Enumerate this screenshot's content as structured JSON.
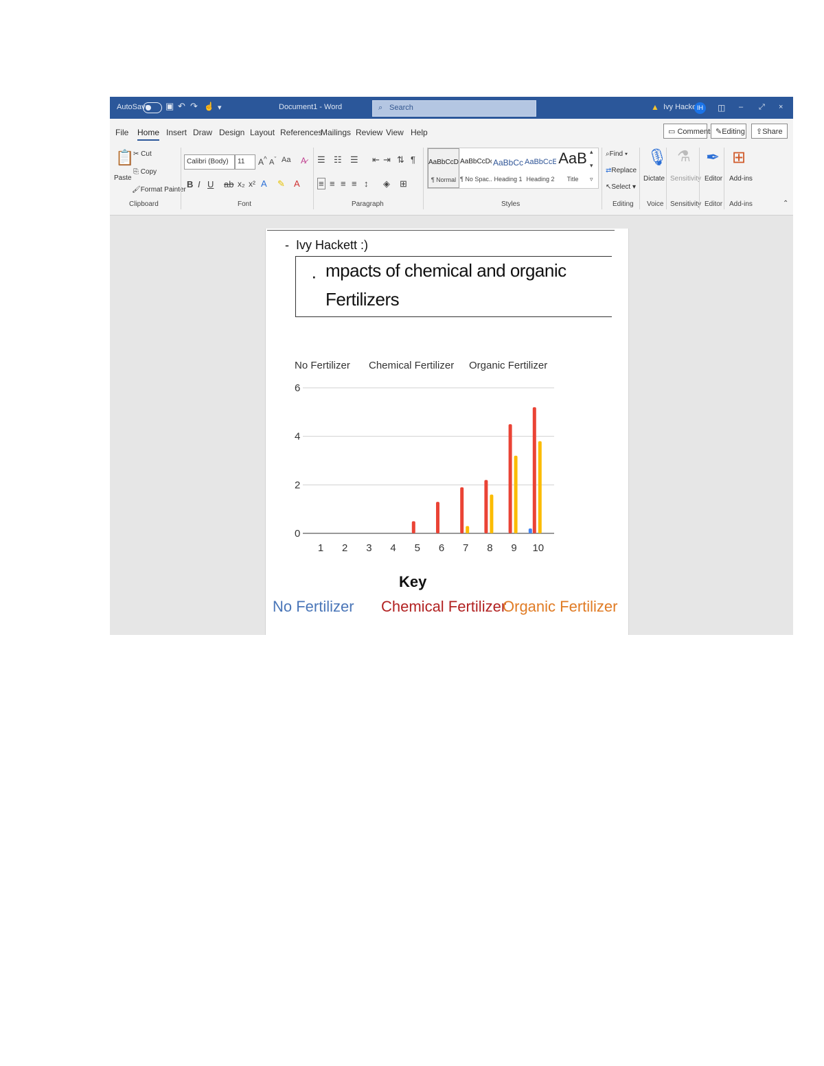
{
  "titlebar": {
    "autosave_label": "AutoSave",
    "autosave_state": "Off",
    "document_title": "Document1 - Word",
    "search_placeholder": "Search",
    "user_name": "Ivy Hacket",
    "user_initials": "IH",
    "minimize": "–",
    "restore": "⤢",
    "close": "×"
  },
  "tabs": [
    "File",
    "Home",
    "Insert",
    "Draw",
    "Design",
    "Layout",
    "References",
    "Mailings",
    "Review",
    "View",
    "Help"
  ],
  "actions": {
    "comments": "Comments",
    "editing": "Editing",
    "share": "Share"
  },
  "ribbon": {
    "clipboard": {
      "paste": "Paste",
      "cut": "Cut",
      "copy": "Copy",
      "format_painter": "Format Painter",
      "group": "Clipboard"
    },
    "font": {
      "font_name": "Calibri (Body)",
      "font_size": "11",
      "group": "Font"
    },
    "paragraph": {
      "group": "Paragraph"
    },
    "styles": {
      "items": [
        {
          "preview": "AaBbCcDc",
          "name": "¶ Normal"
        },
        {
          "preview": "AaBbCcDc",
          "name": "¶ No Spac..."
        },
        {
          "preview": "AaBbCc",
          "name": "Heading 1"
        },
        {
          "preview": "AaBbCcE",
          "name": "Heading 2"
        },
        {
          "preview": "AaB",
          "name": "Title"
        }
      ],
      "group": "Styles"
    },
    "editing": {
      "find": "Find",
      "replace": "Replace",
      "select": "Select",
      "group": "Editing"
    },
    "voice": {
      "dictate": "Dictate",
      "group": "Voice"
    },
    "sensitivity": {
      "label": "Sensitivity",
      "group": "Sensitivity"
    },
    "editor": {
      "label": "Editor",
      "group": "Editor"
    },
    "addins": {
      "label": "Add-ins",
      "group": "Add-ins"
    }
  },
  "document": {
    "author_line": "Ivy Hackett :)",
    "title_line1": "mpacts of chemical and organic",
    "title_line2": "Fertilizers",
    "key_title": "Key",
    "key_items": [
      {
        "label": "No Fertilizer",
        "color": "#4a76b8"
      },
      {
        "label": "Chemical Fertilizer",
        "color": "#b22222"
      },
      {
        "label": "Organic Fertilizer",
        "color": "#e07b24"
      }
    ]
  },
  "chart_data": {
    "type": "bar",
    "categories": [
      "1",
      "2",
      "3",
      "4",
      "5",
      "6",
      "7",
      "8",
      "9",
      "10"
    ],
    "series": [
      {
        "name": "No Fertilizer",
        "color": "#4285f4",
        "values": [
          0,
          0,
          0,
          0,
          0,
          0,
          0,
          0,
          0,
          0.2
        ]
      },
      {
        "name": "Chemical Fertilizer",
        "color": "#ea4335",
        "values": [
          0,
          0,
          0,
          0,
          0.5,
          1.3,
          1.9,
          2.2,
          4.5,
          5.2
        ]
      },
      {
        "name": "Organic Fertilizer",
        "color": "#fbbc04",
        "values": [
          0,
          0,
          0,
          0,
          0,
          0,
          0.3,
          1.6,
          3.2,
          3.8
        ]
      }
    ],
    "ylim": [
      0,
      6
    ],
    "yticks": [
      "0",
      "2",
      "4",
      "6"
    ],
    "grid": true,
    "legend": "top",
    "title": "",
    "xlabel": "",
    "ylabel": ""
  }
}
